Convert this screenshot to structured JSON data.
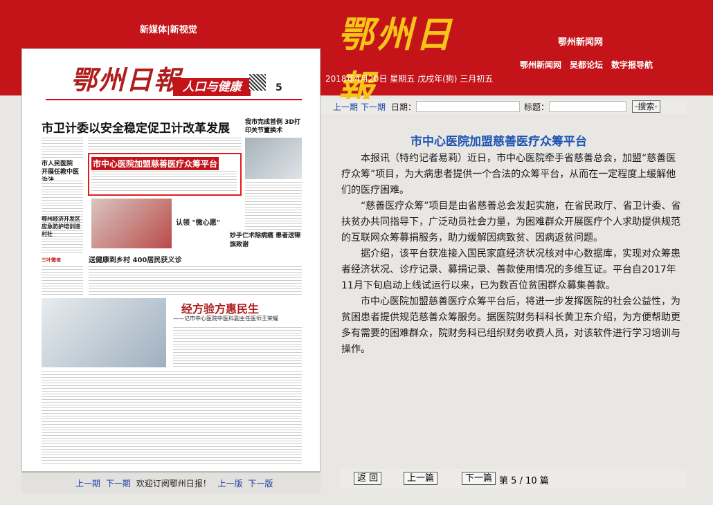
{
  "header": {
    "left_nav": "新媒体|新视觉",
    "logo": "鄂州日報",
    "site_name": "鄂州新闻网",
    "nav": [
      "鄂州新闻网",
      "吴都论坛",
      "数字报导航"
    ],
    "date": "2018年4月20日 星期五 戊戌年(狗) 三月初五"
  },
  "paper": {
    "masthead": "鄂州日報",
    "section": "人口与健康",
    "page_number": "5",
    "main_headline": "市卫计委以安全稳定促卫计改革发展",
    "side_headline": "我市完成首例 3D打印关节置换术",
    "highlight": "市中心医院加盟慈善医疗众筹平台",
    "left_heads": [
      "市人民医院",
      "开展任教中医治法"
    ],
    "sub1": "认领 \"微心愿\"",
    "sub2": "送健康到乡村   400居民获义诊",
    "sub3": "妙手仁术除病痛 患者送锦旗致谢",
    "sub4": "鄂州经济开发区 应急防护培训进村社",
    "brand_strip": "三叶微信",
    "big_head": "经方验方惠民生",
    "big_sub": "——记市中心医院中医科副主任医师王荣耀"
  },
  "left_bottom": {
    "prev_issue": "上一期",
    "next_issue": "下一期",
    "welcome": "欢迎订阅鄂州日报！",
    "prev_page": "上一版",
    "next_page": "下一版"
  },
  "search": {
    "prev_issue": "上一期",
    "next_issue": "下一期",
    "date_label": "日期：",
    "title_label": "标题：",
    "button": "-搜索-"
  },
  "article": {
    "title": "市中心医院加盟慈善医疗众筹平台",
    "paragraphs": [
      "本报讯（特约记者易莉）近日，市中心医院牵手省慈善总会，加盟“慈善医疗众筹”项目，为大病患者提供一个合法的众筹平台，从而在一定程度上缓解他们的医疗困难。",
      "“慈善医疗众筹”项目是由省慈善总会发起实施，在省民政厅、省卫计委、省扶贫办共同指导下，广泛动员社会力量，为困难群众开展医疗个人求助提供规范的互联网众筹募捐服务，助力缓解因病致贫、因病返贫问题。",
      "据介绍，该平台获准接入国民家庭经济状况核对中心数据库，实现对众筹患者经济状况、诊疗记录、募捐记录、善款使用情况的多维互证。平台自2017年11月下旬启动上线试运行以来，已为数百位贫困群众募集善款。",
      "市中心医院加盟慈善医疗众筹平台后，将进一步发挥医院的社会公益性，为贫困患者提供规范慈善众筹服务。据医院财务科科长黄卫东介绍，为方便帮助更多有需要的困难群众，院财务科已组织财务收费人员，对该软件进行学习培训与操作。"
    ]
  },
  "right_bottom": {
    "back": "返 回",
    "prev": "上一篇",
    "next": "下一篇",
    "page_info": "第 5 / 10 篇"
  },
  "colors": {
    "header_red": "#c4141a",
    "link_blue": "#1b3fa8",
    "title_blue": "#1e55b3",
    "logo_gold": "#f5c518"
  }
}
